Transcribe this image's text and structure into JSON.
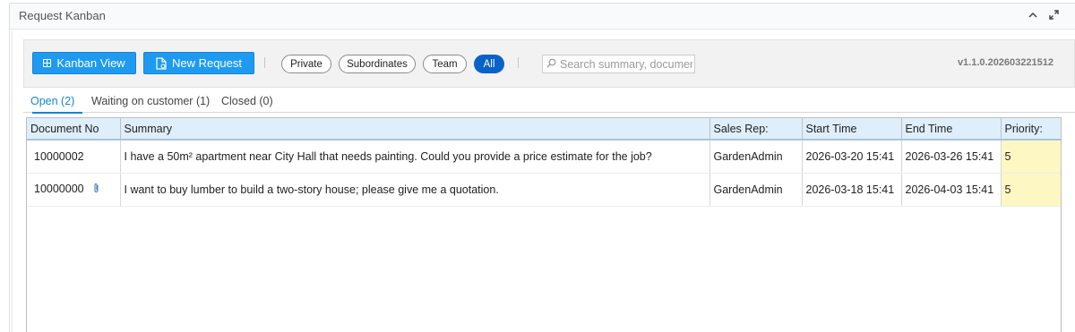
{
  "panel": {
    "title": "Request Kanban",
    "collapse_icon": "chevron-up-icon",
    "expand_icon": "expand-arrows-icon"
  },
  "toolbar": {
    "kanban_view_label": "Kanban View",
    "kanban_view_icon": "grid-icon",
    "new_request_label": "New Request",
    "new_request_icon": "document-icon",
    "filters": [
      "Private",
      "Subordinates",
      "Team",
      "All"
    ],
    "active_filter": "All",
    "search_placeholder": "Search summary, document",
    "search_icon": "search-icon",
    "version": "v1.1.0.202603221512",
    "accent_color": "#1e9af0",
    "active_pill_color": "#0a62c9"
  },
  "tabs": [
    {
      "label": "Open (2)",
      "active": true
    },
    {
      "label": "Waiting on customer (1)",
      "active": false
    },
    {
      "label": "Closed (0)",
      "active": false
    }
  ],
  "table": {
    "columns": [
      "Document No",
      "Summary",
      "Sales Rep:",
      "Start Time",
      "End Time",
      "Priority:"
    ],
    "rows": [
      {
        "doc_no": "10000002",
        "attachment": false,
        "summary": "I have a 50m² apartment near City Hall that needs painting. Could you provide a price estimate for the job?",
        "sales_rep": "GardenAdmin",
        "start": "2026-03-20 15:41",
        "end": "2026-03-26 15:41",
        "priority": "5"
      },
      {
        "doc_no": "10000000",
        "attachment": true,
        "summary": "I want to buy lumber to build a two-story house; please give me a quotation.",
        "sales_rep": "GardenAdmin",
        "start": "2026-03-18 15:41",
        "end": "2026-04-03 15:41",
        "priority": "5"
      }
    ],
    "attachment_icon": "paperclip-icon",
    "priority_highlight_color": "#fdf7c4"
  }
}
